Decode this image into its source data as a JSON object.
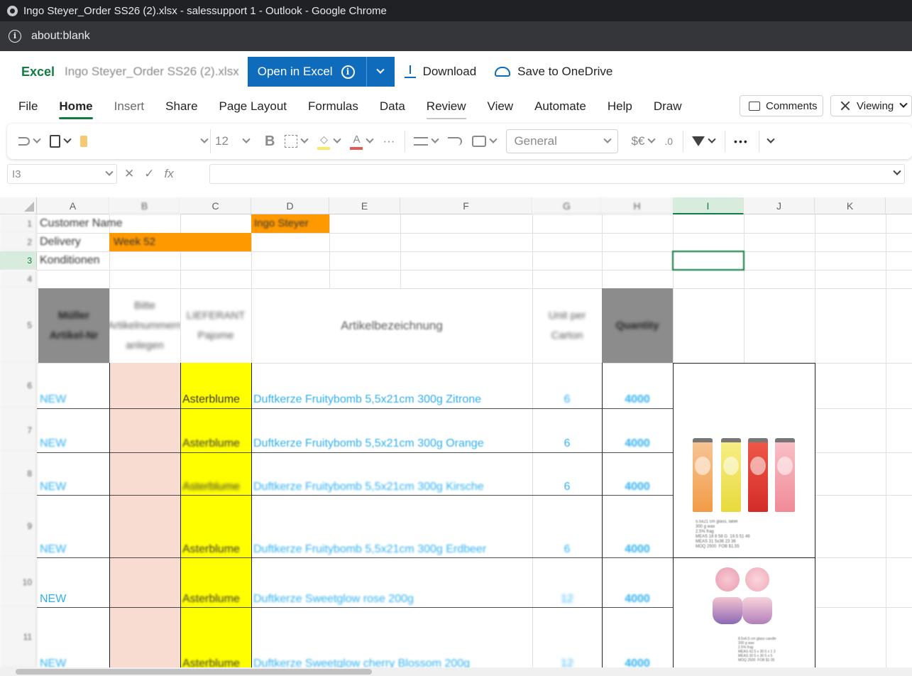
{
  "browser": {
    "window_title": "Ingo Steyer_Order SS26 (2).xlsx - salessupport 1 - Outlook - Google Chrome",
    "address": "about:blank"
  },
  "app": {
    "brand": "Excel",
    "file_name": "Ingo Steyer_Order SS26 (2).xlsx",
    "open_in_excel": "Open in Excel",
    "download": "Download",
    "save_to_onedrive": "Save to OneDrive"
  },
  "menu": {
    "tabs": [
      "File",
      "Home",
      "Insert",
      "Share",
      "Page Layout",
      "Formulas",
      "Data",
      "Review",
      "View",
      "Automate",
      "Help",
      "Draw"
    ],
    "active": "Home",
    "comments": "Comments",
    "viewing": "Viewing"
  },
  "toolbar": {
    "font_size": "12",
    "bold": "B",
    "more": "···",
    "number_format": "General",
    "currency": "$€",
    "decimals": ".0",
    "overflow": "•••"
  },
  "formula_bar": {
    "name_box": "I3",
    "fx": "fx",
    "cancel": "✕",
    "confirm": "✓",
    "formula": ""
  },
  "grid": {
    "columns": [
      "A",
      "B",
      "C",
      "D",
      "E",
      "F",
      "G",
      "H",
      "I",
      "J",
      "K"
    ],
    "selected_column": "I",
    "rows": [
      "1",
      "2",
      "3",
      "4",
      "5",
      "6",
      "7",
      "8",
      "9",
      "10",
      "11"
    ],
    "selected_row": "3",
    "info": {
      "customer_label": "Customer Name",
      "customer_value": "Ingo Steyer",
      "delivery_label": "Delivery",
      "delivery_value": "Week 52",
      "conditions_label": "Konditionen"
    },
    "headers": {
      "a": "Müller Artikel-Nr",
      "b": "Bitte Artikelnummern anlegen",
      "c": "LIEFERANT Pajome",
      "d": "Artikelbezeichnung",
      "g": "Unit per Carton",
      "h": "Quantity"
    },
    "items": [
      {
        "a": "NEW",
        "c": "Asterblume",
        "d": "Duftkerze Fruitybomb 5,5x21cm 300g Zitrone",
        "g": "6",
        "h": "4000"
      },
      {
        "a": "NEW",
        "c": "Asterblume",
        "d": "Duftkerze Fruitybomb 5,5x21cm 300g Orange",
        "g": "6",
        "h": "4000"
      },
      {
        "a": "NEW",
        "c": "Asterblume",
        "d": "Duftkerze Fruitybomb 5,5x21cm 300g Kirsche",
        "g": "6",
        "h": "4000"
      },
      {
        "a": "NEW",
        "c": "Asterblume",
        "d": "Duftkerze Fruitybomb 5,5x21cm 300g Erdbeer",
        "g": "6",
        "h": "4000"
      },
      {
        "a": "NEW",
        "c": "Asterblume",
        "d": "Duftkerze Sweetglow rose 200g",
        "g": "12",
        "h": "4000"
      },
      {
        "a": "NEW",
        "c": "Asterblume",
        "d": "Duftkerze Sweetglow cherry Blossom 200g",
        "g": "12",
        "h": "4000"
      }
    ],
    "image_captions": {
      "candles": "5.5x21 cm glass, label\n300 g wax\n2.5% frag\nMEAS 18 8 58 G  19.5 51 46\nMEAS 31 5x36 23 36\nMOQ 2500  FOB $1.55",
      "jars": "8.5x6.5 cm glass candle\n200 g wax\n2.5% frag\nMEAS 42.5 x 30 5 x 1 3\nMEAS 30 5 x 30 5 x 5\nMOQ 2500  FOB $1 05"
    }
  },
  "colors": {
    "excel_green": "#107c41",
    "primary_blue": "#0f6cbd",
    "orange_fill": "#ff9900",
    "yellow_fill": "#ffff00",
    "pink_fill": "#f8dcd1",
    "grey_fill": "#8c8c8c",
    "link_blue": "#2fb0ef"
  }
}
